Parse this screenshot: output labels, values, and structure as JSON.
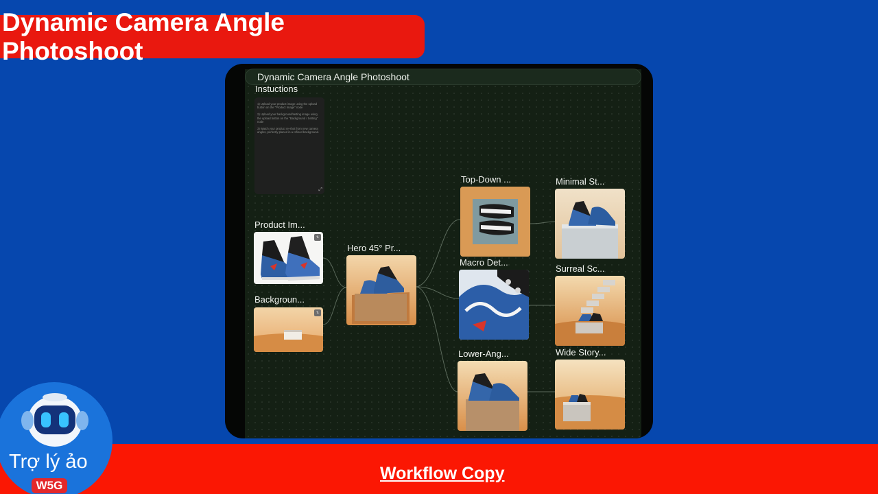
{
  "header": {
    "title": "Dynamic Camera Angle Photoshoot"
  },
  "workflow": {
    "canvas_title": "Dynamic Camera Angle Photoshoot",
    "instructions": {
      "label": "Instuctions",
      "lines": [
        "1) Upload your product image using the upload button on the \"Product Image\" node",
        "2) Upload your background/setting image using the upload button on the \"Background / Setting\" node",
        "3) Watch your product re-shot from new camera angles, perfectly placed in a refined background."
      ]
    },
    "nodes": {
      "product_image": "Product Im...",
      "background": "Backgroun...",
      "hero": "Hero 45° Pr...",
      "top_down": "Top-Down ...",
      "macro": "Macro Det...",
      "lower_angle": "Lower-Ang...",
      "minimal": "Minimal St...",
      "surreal": "Surreal Sc...",
      "wide_story": "Wide Story..."
    }
  },
  "footer": {
    "link": "Workflow Copy"
  },
  "assistant": {
    "name": "Trợ lý ảo",
    "badge": "W5G"
  },
  "colors": {
    "background": "#0647ae",
    "banner": "#e9180f",
    "bottom_bar": "#fb1703",
    "canvas": "#142014",
    "sand": "#d8954a"
  }
}
